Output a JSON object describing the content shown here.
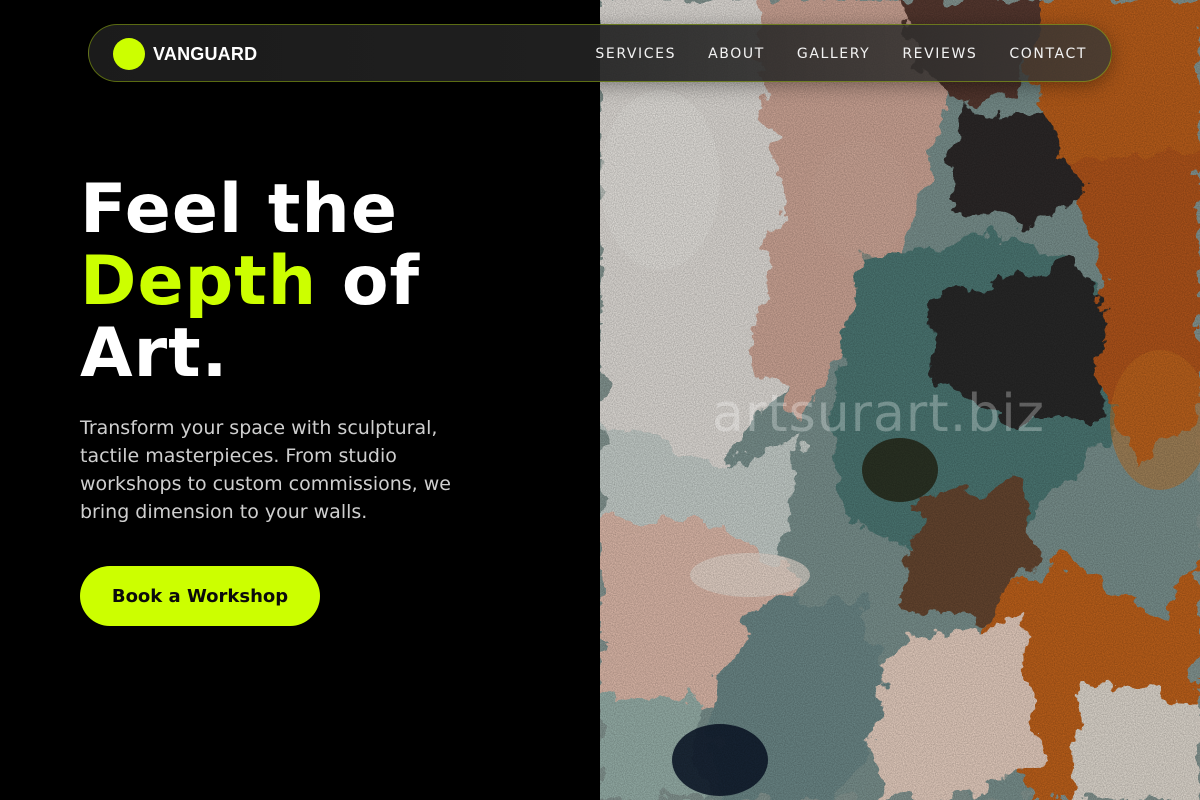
{
  "brand": {
    "name": "VANGUARD",
    "accent_color": "#ccff00"
  },
  "nav": {
    "links": [
      "SERVICES",
      "ABOUT",
      "GALLERY",
      "REVIEWS",
      "CONTACT"
    ]
  },
  "hero": {
    "title_line1": "Feel the",
    "title_accent": "Depth",
    "title_line2_rest": " of",
    "title_line3": "Art.",
    "description": "Transform your space with sculptural, tactile masterpieces. From studio workshops to custom commissions, we bring dimension to your walls.",
    "cta_label": "Book a Workshop"
  },
  "image": {
    "subject": "textured-impasto-painting-icon",
    "watermark_text": "artsurart.biz",
    "palette": [
      "#f0ece6",
      "#d9b3a3",
      "#c4611c",
      "#2a2624",
      "#5f8a86",
      "#0f1b2e"
    ]
  }
}
